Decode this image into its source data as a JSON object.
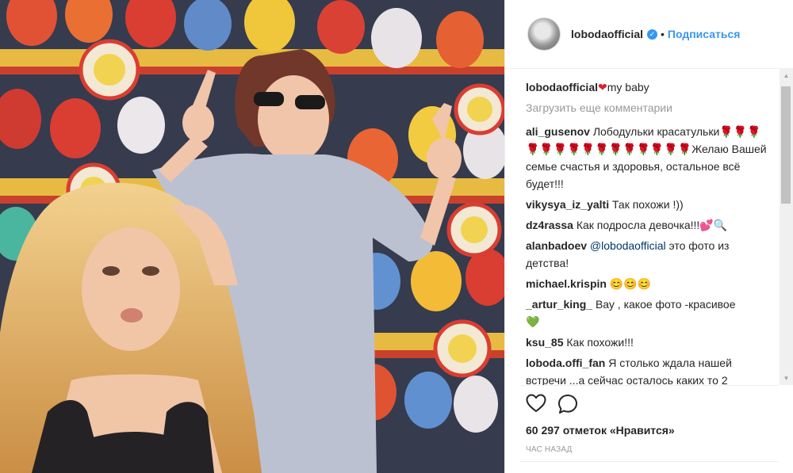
{
  "post": {
    "username": "lobodaofficial",
    "verified_icon": "verified-badge-icon",
    "separator": "•",
    "follow_label": "Подписаться"
  },
  "caption": {
    "username": "lobodaofficial",
    "emoji": "❤",
    "text": "my baby"
  },
  "load_more_label": "Загрузить еще комментарии",
  "comments": [
    {
      "username": "ali_gusenov",
      "text": "Лободульки красатульки",
      "emoji": "🌹🌹🌹🌹🌹🌹🌹🌹🌹🌹🌹🌹🌹🌹🌹",
      "text2": "Желаю Вашей семье счастья и здоровья, остальное всё будет!!!"
    },
    {
      "username": "vikysya_iz_yalti",
      "text": "Так похожи !))"
    },
    {
      "username": "dz4rassa",
      "text": "Как подросла девочка!!!",
      "emoji": "💕🔍"
    },
    {
      "username": "alanbadoev",
      "mention": "@lobodaofficial",
      "text": " это фото из детства!"
    },
    {
      "username": "michael.krispin",
      "emoji": "😊😊😊"
    },
    {
      "username": "_artur_king_",
      "text": "Вау , какое фото -красивое",
      "emoji": "💚"
    },
    {
      "username": "ksu_85",
      "text": "Как похожи!!!"
    },
    {
      "username": "loboda.offi_fan",
      "text": "Я столько ждала нашей встречи ...а сейчас осталось каких то 2"
    }
  ],
  "actions": {
    "like_icon": "heart-icon",
    "comment_icon": "comment-icon"
  },
  "likes_text": "60 297 отметок «Нравится»",
  "time_text": "ЧАС НАЗАД",
  "colors": {
    "accent": "#3897f0",
    "text": "#262626",
    "muted": "#999999",
    "border": "#efefef"
  }
}
